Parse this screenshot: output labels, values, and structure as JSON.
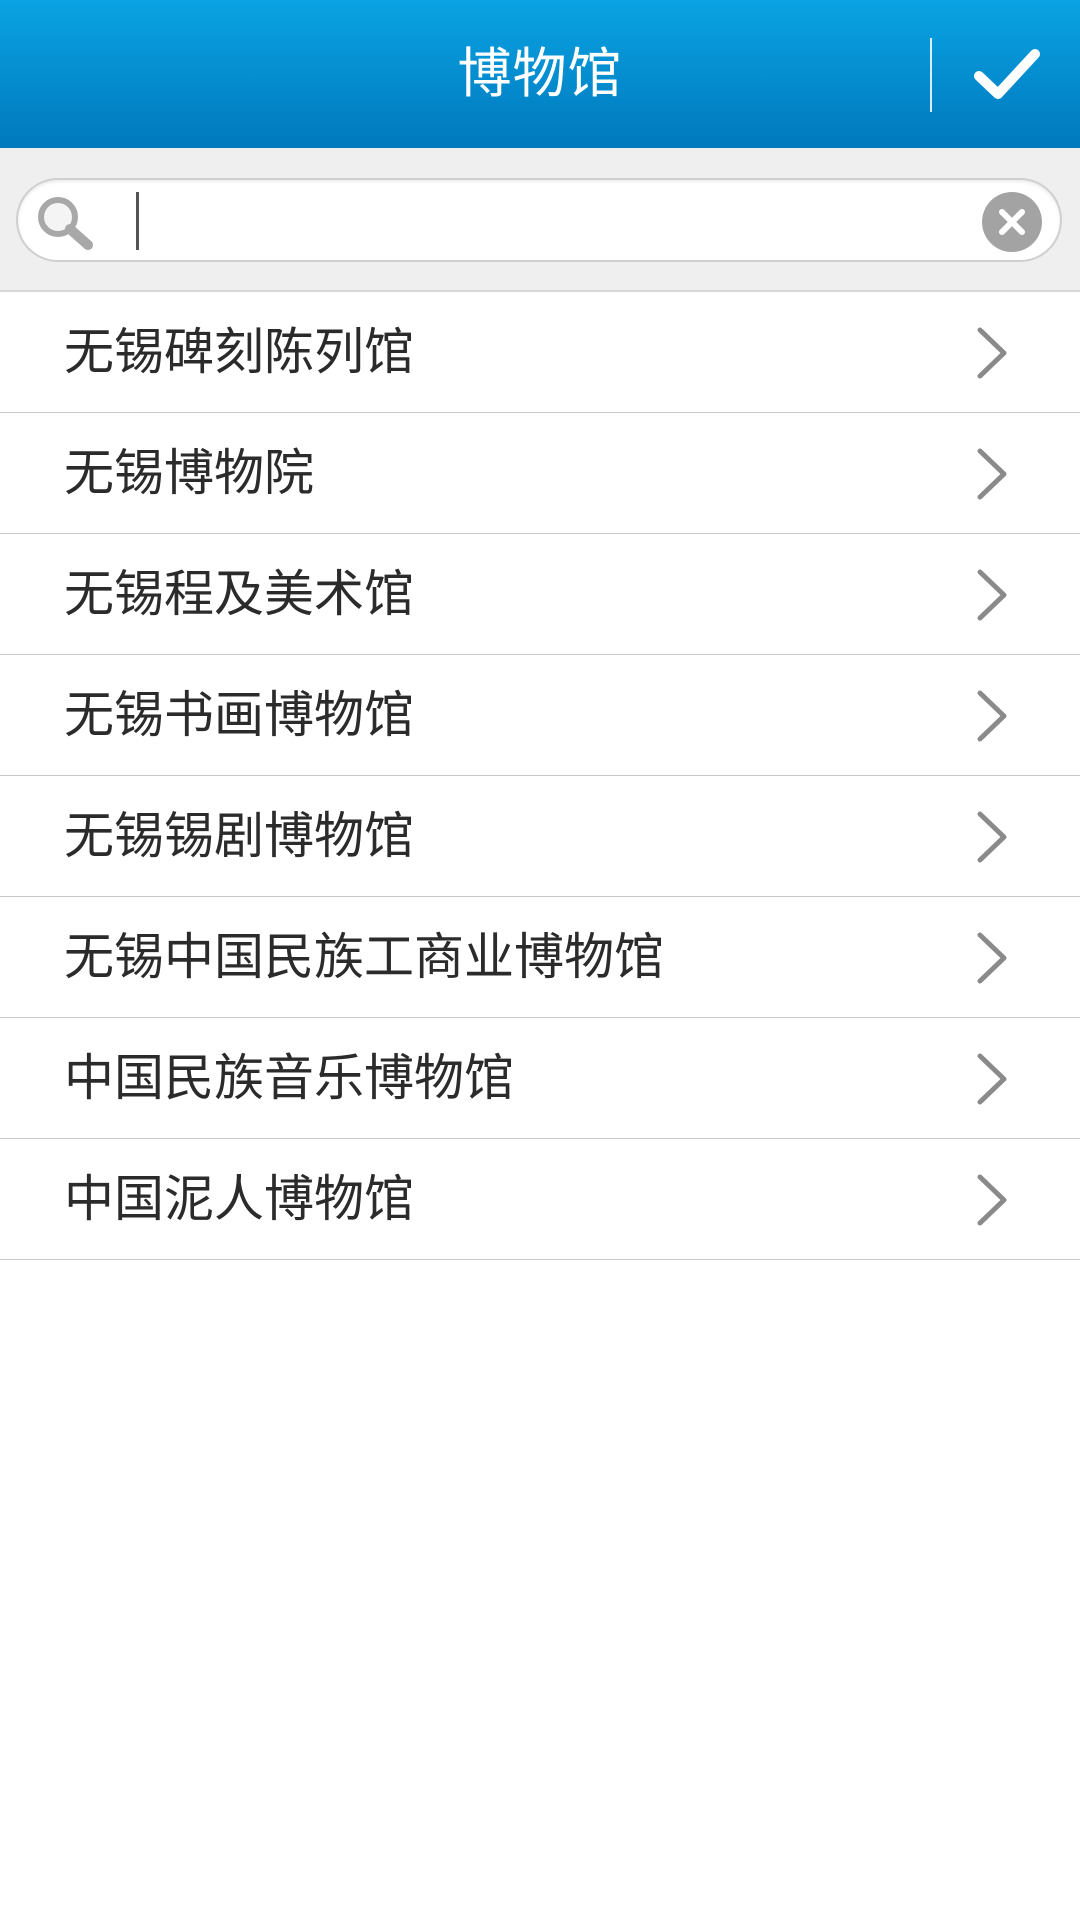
{
  "header": {
    "title": "博物馆",
    "confirm_icon": "checkmark-icon"
  },
  "search": {
    "value": "",
    "placeholder": "",
    "search_icon": "search-icon",
    "clear_icon": "clear-icon"
  },
  "list": {
    "items": [
      {
        "label": "无锡碑刻陈列馆"
      },
      {
        "label": "无锡博物院"
      },
      {
        "label": "无锡程及美术馆"
      },
      {
        "label": "无锡书画博物馆"
      },
      {
        "label": "无锡锡剧博物馆"
      },
      {
        "label": "无锡中国民族工商业博物馆"
      },
      {
        "label": "中国民族音乐博物馆"
      },
      {
        "label": "中国泥人博物馆"
      }
    ],
    "chevron_icon": "chevron-right-icon"
  },
  "colors": {
    "header_top": "#0aa3e3",
    "header_bottom": "#0079bd",
    "text": "#2b2b2b",
    "divider": "#c7c7c7"
  }
}
